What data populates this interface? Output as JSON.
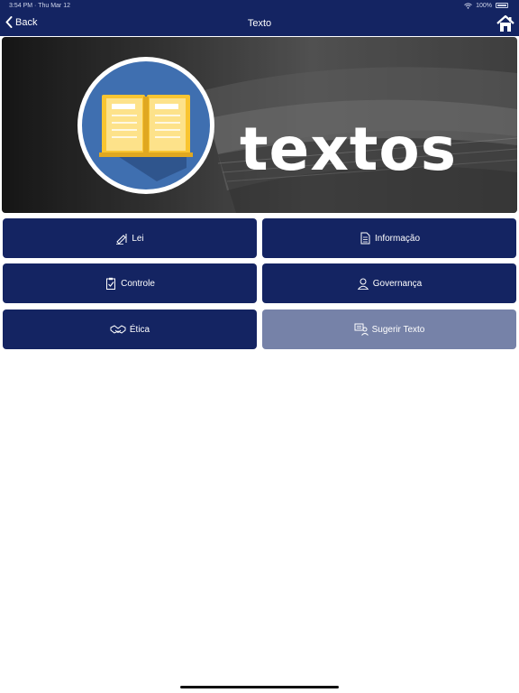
{
  "status_bar": {
    "time": "3:54 PM",
    "date": "Thu Mar 12",
    "battery": "100%"
  },
  "nav": {
    "back_label": "Back",
    "title": "Texto"
  },
  "banner": {
    "word": "textos"
  },
  "tiles": [
    {
      "label": "Lei",
      "icon": "pen-icon"
    },
    {
      "label": "Informação",
      "icon": "document-icon"
    },
    {
      "label": "Controle",
      "icon": "clipboard-check-icon"
    },
    {
      "label": "Governança",
      "icon": "person-icon"
    },
    {
      "label": "Ética",
      "icon": "handshake-icon"
    },
    {
      "label": "Sugerir Texto",
      "icon": "suggest-icon",
      "style": "muted"
    }
  ],
  "colors": {
    "nav_bg": "#142462",
    "tile_bg": "#142462",
    "tile_muted_bg": "#7682a8",
    "banner_circle": "#3f6fb0",
    "book_yellow": "#f9c531"
  }
}
